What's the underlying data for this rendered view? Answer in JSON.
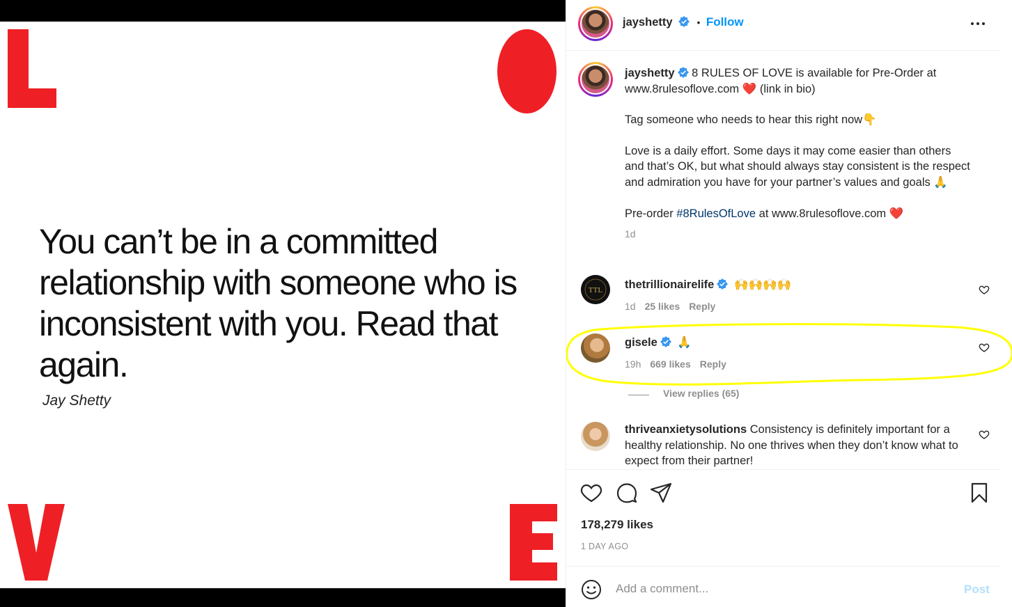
{
  "image": {
    "quote": "You can’t be in a committed relationship with someone who is inconsistent with you. Read that again.",
    "author": "Jay Shetty",
    "letters": [
      "L",
      "O",
      "V",
      "E"
    ],
    "accent_color": "#ee2026"
  },
  "header": {
    "username": "jayshetty",
    "separator": "•",
    "follow_label": "Follow"
  },
  "caption": {
    "username": "jayshetty",
    "line1": "8 RULES OF LOVE is available for Pre-Order at",
    "line1_link": "www.8rulesoflove.com",
    "line1_tail": "(link in bio)",
    "line2": "Tag someone who needs to hear this right now👇",
    "line3": "Love is a daily effort. Some days it may come easier than others and that’s OK, but what should always stay consistent is the respect and admiration you have for your partner’s values and goals 🙏",
    "line4_prefix": "Pre-order",
    "line4_hashtag": "#8RulesOfLove",
    "line4_mid": "at",
    "line4_link": "www.8rulesoflove.com",
    "time": "1d"
  },
  "comments": [
    {
      "username": "thetrillionairelife",
      "text": "🙌🙌🙌🙌",
      "time": "1d",
      "likes": "25 likes",
      "reply": "Reply"
    },
    {
      "username": "gisele",
      "text": "🙏",
      "time": "19h",
      "likes": "669 likes",
      "reply": "Reply"
    },
    {
      "username": "thriveanxietysolutions",
      "text": "Consistency is definitely important for a healthy relationship. No one thrives when they don’t know what to expect from their partner!"
    }
  ],
  "view_replies": "View replies (65)",
  "actions": {
    "likes": "178,279 likes",
    "timestamp": "1 DAY AGO"
  },
  "add_comment": {
    "placeholder": "Add a comment...",
    "post_label": "Post"
  },
  "colors": {
    "link_blue": "#0095f6",
    "hashtag": "#00376b",
    "highlight": "#ffff00",
    "secondary_text": "#8e8e8e"
  }
}
